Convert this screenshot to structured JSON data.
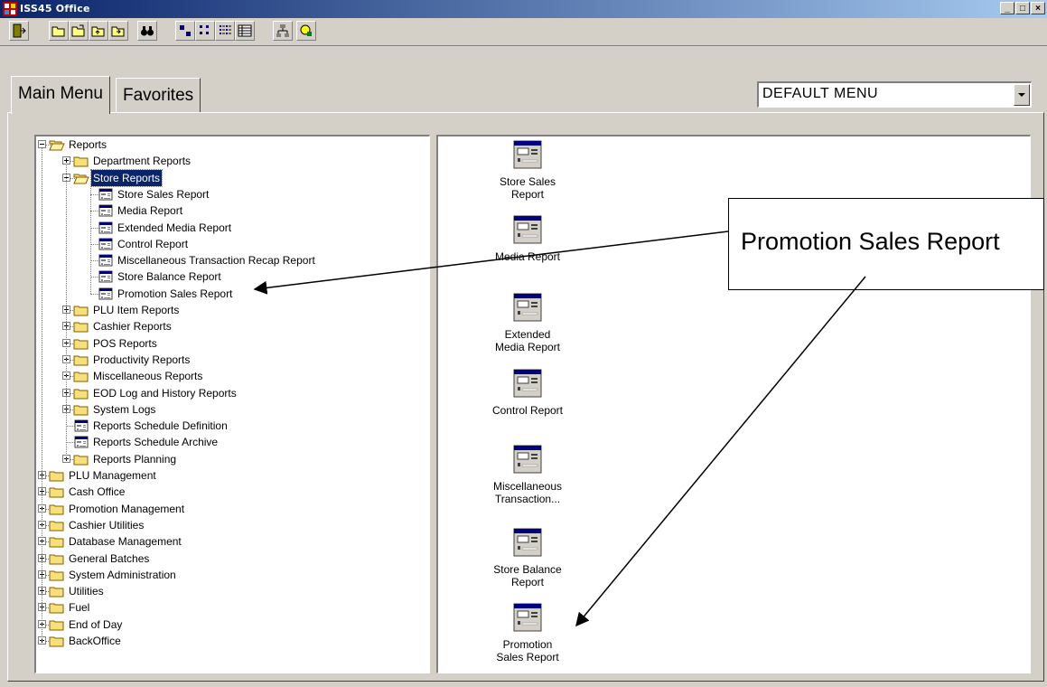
{
  "window": {
    "title": "ISS45 Office",
    "controls": [
      "_",
      "□",
      "×"
    ]
  },
  "toolbar": {
    "buttons": [
      "exit-icon",
      "open-folder-icon",
      "open-folder-2-icon",
      "folder-up-icon",
      "folder-down-icon",
      "find-binoculars-icon",
      "large-icons-view-icon",
      "small-icons-view-icon",
      "list-view-icon",
      "details-view-icon",
      "network-icon",
      "help-icon"
    ]
  },
  "tabs": [
    {
      "label": "Main Menu"
    },
    {
      "label": "Favorites"
    }
  ],
  "menu_select": {
    "value": "DEFAULT MENU"
  },
  "tree": [
    {
      "label": "Reports",
      "level": 0,
      "kind": "folder-open",
      "expander": "minus"
    },
    {
      "label": "Department Reports",
      "level": 1,
      "kind": "folder",
      "expander": "plus"
    },
    {
      "label": "Store Reports",
      "level": 1,
      "kind": "folder-open",
      "expander": "minus",
      "selected": true
    },
    {
      "label": "Store Sales Report",
      "level": 2,
      "kind": "report"
    },
    {
      "label": "Media Report",
      "level": 2,
      "kind": "report"
    },
    {
      "label": "Extended Media Report",
      "level": 2,
      "kind": "report"
    },
    {
      "label": "Control Report",
      "level": 2,
      "kind": "report"
    },
    {
      "label": "Miscellaneous Transaction Recap Report",
      "level": 2,
      "kind": "report"
    },
    {
      "label": "Store Balance Report",
      "level": 2,
      "kind": "report"
    },
    {
      "label": "Promotion Sales Report",
      "level": 2,
      "kind": "report"
    },
    {
      "label": "PLU Item Reports",
      "level": 1,
      "kind": "folder",
      "expander": "plus"
    },
    {
      "label": "Cashier Reports",
      "level": 1,
      "kind": "folder",
      "expander": "plus"
    },
    {
      "label": "POS Reports",
      "level": 1,
      "kind": "folder",
      "expander": "plus"
    },
    {
      "label": "Productivity Reports",
      "level": 1,
      "kind": "folder",
      "expander": "plus"
    },
    {
      "label": "Miscellaneous Reports",
      "level": 1,
      "kind": "folder",
      "expander": "plus"
    },
    {
      "label": "EOD Log and History Reports",
      "level": 1,
      "kind": "folder",
      "expander": "plus"
    },
    {
      "label": "System Logs",
      "level": 1,
      "kind": "folder",
      "expander": "plus"
    },
    {
      "label": "Reports Schedule Definition",
      "level": 1,
      "kind": "report"
    },
    {
      "label": "Reports Schedule Archive",
      "level": 1,
      "kind": "report"
    },
    {
      "label": "Reports Planning",
      "level": 1,
      "kind": "folder",
      "expander": "plus"
    },
    {
      "label": "PLU Management",
      "level": 0,
      "kind": "folder",
      "expander": "plus"
    },
    {
      "label": "Cash Office",
      "level": 0,
      "kind": "folder",
      "expander": "plus"
    },
    {
      "label": "Promotion Management",
      "level": 0,
      "kind": "folder",
      "expander": "plus"
    },
    {
      "label": "Cashier Utilities",
      "level": 0,
      "kind": "folder",
      "expander": "plus"
    },
    {
      "label": "Database Management",
      "level": 0,
      "kind": "folder",
      "expander": "plus"
    },
    {
      "label": "General Batches",
      "level": 0,
      "kind": "folder",
      "expander": "plus"
    },
    {
      "label": "System Administration",
      "level": 0,
      "kind": "folder",
      "expander": "plus"
    },
    {
      "label": "Utilities",
      "level": 0,
      "kind": "folder",
      "expander": "plus"
    },
    {
      "label": "Fuel",
      "level": 0,
      "kind": "folder",
      "expander": "plus"
    },
    {
      "label": "End of Day",
      "level": 0,
      "kind": "folder",
      "expander": "plus"
    },
    {
      "label": "BackOffice",
      "level": 0,
      "kind": "folder",
      "expander": "plus"
    }
  ],
  "icon_items": [
    {
      "lines": [
        "Store Sales",
        "Report"
      ]
    },
    {
      "lines": [
        "Media Report"
      ]
    },
    {
      "lines": [
        "Extended",
        "Media Report"
      ]
    },
    {
      "lines": [
        "Control Report"
      ]
    },
    {
      "lines": [
        "Miscellaneous",
        "Transaction..."
      ]
    },
    {
      "lines": [
        "Store Balance",
        "Report"
      ]
    },
    {
      "lines": [
        "Promotion",
        "Sales Report"
      ]
    }
  ],
  "callout": {
    "text": "Promotion Sales Report"
  }
}
